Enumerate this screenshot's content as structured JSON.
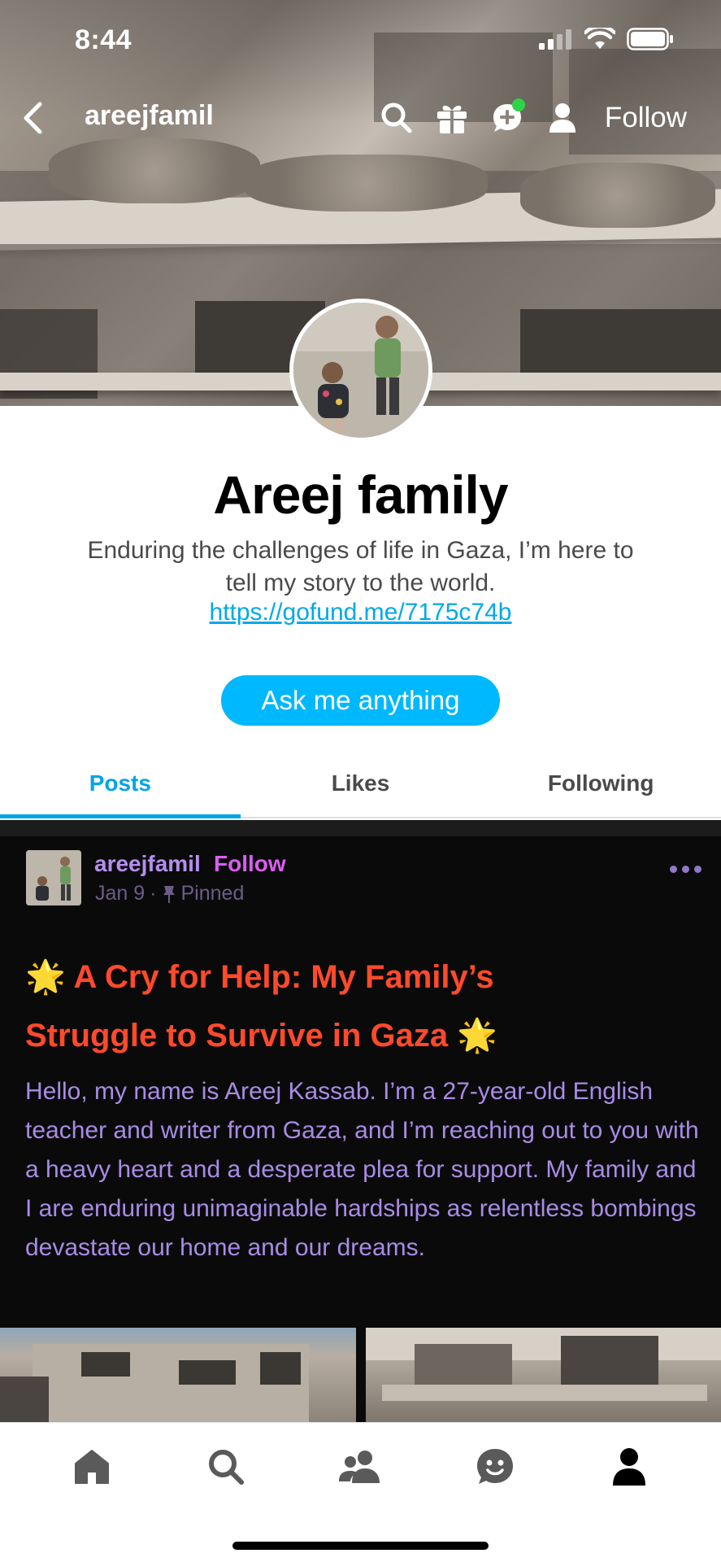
{
  "status_bar": {
    "time": "8:44"
  },
  "nav": {
    "username": "areejfamil",
    "follow_label": "Follow",
    "icons": [
      "back-icon",
      "search-icon",
      "gift-icon",
      "chat-icon",
      "user-icon"
    ]
  },
  "profile": {
    "name": "Areej family",
    "bio_line1": "Enduring the challenges of life in Gaza, I’m here to",
    "bio_line2": "tell my story to the world.",
    "link": "https://gofund.me/7175c74b",
    "ask_button": "Ask me anything"
  },
  "tabs": [
    {
      "label": "Posts",
      "active": true
    },
    {
      "label": "Likes",
      "active": false
    },
    {
      "label": "Following",
      "active": false
    }
  ],
  "post": {
    "username": "areejfamil",
    "follow_label": "Follow",
    "date": "Jan 9",
    "pinned_label": "Pinned",
    "title_line1": "A Cry for Help: My Family’s",
    "title_line2": "Struggle to Survive in Gaza",
    "title_emoji": "🌟",
    "body": "Hello, my name is Areej Kassab. I’m a 27-year-old English teacher and writer from Gaza, and I’m reaching out to you with a heavy heart and a desperate plea for support. My family and I are enduring unimaginable hardships as relentless bombings devastate our home and our dreams."
  },
  "bottom_nav": [
    "home-icon",
    "search-icon",
    "people-icon",
    "smile-icon",
    "profile-icon"
  ],
  "colors": {
    "accent": "#00b8ff",
    "post_bg": "#0b0a0b",
    "title": "#ff4a2b",
    "body_text": "#a88ce6",
    "username": "#b48fef",
    "follow": "#d95ef0"
  }
}
